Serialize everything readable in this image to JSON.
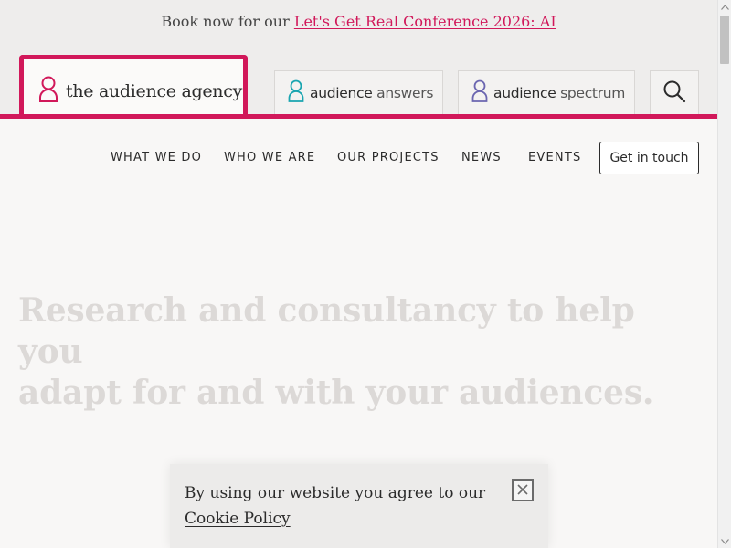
{
  "banner": {
    "prefix": "Book now for our ",
    "link_text": "Let's Get Real Conference 2026: AI"
  },
  "brand": {
    "name": "the audience agency",
    "icon": "person-outline-icon",
    "color": "#d1185a"
  },
  "sub_sites": {
    "answers": {
      "word1": "audience",
      "word2": "answers",
      "icon": "person-outline-icon",
      "color": "#1aa5b0"
    },
    "spectrum": {
      "word1": "audience",
      "word2": "spectrum",
      "icon": "person-outline-icon",
      "color": "#6b66b0"
    }
  },
  "search": {
    "icon": "search-icon"
  },
  "nav": {
    "items": [
      "WHAT WE DO",
      "WHO WE ARE",
      "OUR PROJECTS",
      "NEWS",
      "EVENTS"
    ],
    "cta": "Get in touch"
  },
  "hero": {
    "line1": "Research and consultancy to help you",
    "line2": "adapt for and with your audiences."
  },
  "cookie": {
    "text": "By using our website you agree to our",
    "link": "Cookie Policy",
    "close_icon": "close-icon"
  }
}
